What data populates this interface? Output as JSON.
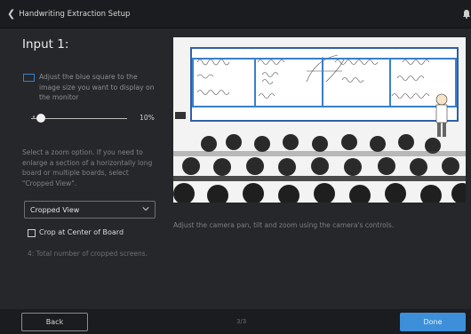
{
  "titlebar": {
    "back_icon": "chevron-left-icon",
    "title": "Handwriting Extraction Setup",
    "notification_icon": "bell-icon"
  },
  "panel": {
    "heading": "Input 1:",
    "adjust_text": "Adjust the blue square to the image size you want to display on the monitor",
    "zoom_percent": "10%",
    "zoom_value": 0.1,
    "zoom_help": "Select a zoom option. If you need to enlarge a section of a horizontally long board or multiple boards, select \"Cropped View\".",
    "zoom_option_selected": "Cropped View",
    "crop_center_label": "Crop at Center of Board",
    "crop_center_checked": false,
    "total_cropped": "4: Total number of cropped screens."
  },
  "preview": {
    "caption": "Adjust the camera pan, tilt and zoom using the camera's controls.",
    "crop_box_color": "#3a7fc8",
    "board_frame_color": "#2f5fa6"
  },
  "footer": {
    "back_label": "Back",
    "page_indicator": "3/3",
    "done_label": "Done",
    "accent": "#3d8fd9"
  }
}
